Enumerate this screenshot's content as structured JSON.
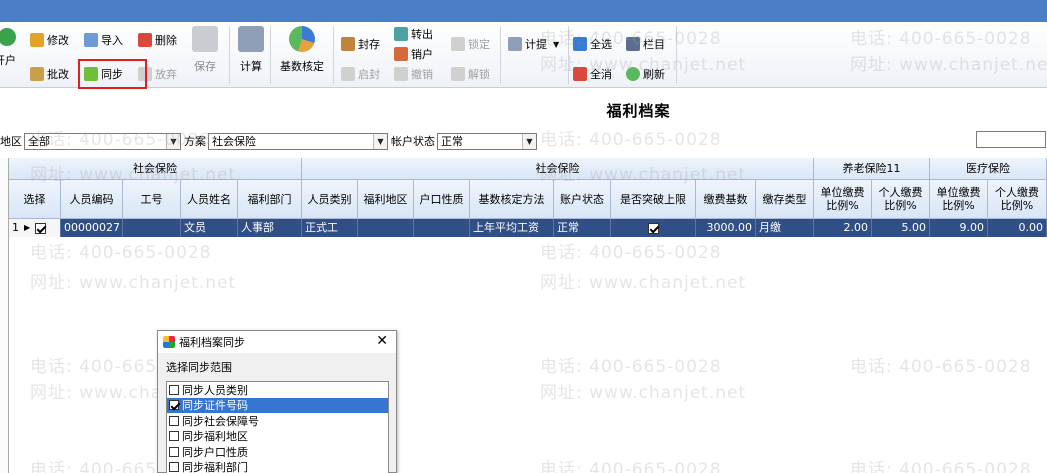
{
  "toolbar": {
    "add_account": "开户",
    "edit": "修改",
    "import": "导入",
    "delete": "删除",
    "batch_edit": "批改",
    "sync": "同步",
    "abandon": "放弃",
    "save": "保存",
    "calculate": "计算",
    "base_verify": "基数核定",
    "seal": "封存",
    "transfer_out": "转出",
    "lock": "锁定",
    "unseal": "启封",
    "cancel_account": "销户",
    "undo_cancel": "撤销",
    "unlock": "解锁",
    "accrue": "计提",
    "select_all": "全选",
    "columns": "栏目",
    "deselect_all": "全消",
    "refresh": "刷新"
  },
  "page_title": "福利档案",
  "filters": {
    "region_label": "地区",
    "region_value": "全部",
    "plan_label": "方案",
    "plan_value": "社会保险",
    "status_label": "帐户状态",
    "status_value": "正常"
  },
  "grid": {
    "group_social1": "社会保险",
    "group_social2": "社会保险",
    "group_pension": "养老保险11",
    "group_medical": "医疗保险",
    "columns": [
      "选择",
      "人员编码",
      "工号",
      "人员姓名",
      "福利部门",
      "人员类别",
      "福利地区",
      "户口性质",
      "基数核定方法",
      "账户状态",
      "是否突破上限",
      "缴费基数",
      "缴存类型",
      "单位缴费比例%",
      "个人缴费比例%",
      "单位缴费比例%",
      "个人缴费比例%"
    ],
    "row": {
      "index": "1",
      "code": "00000027",
      "job_no": "",
      "name": "文员",
      "dept": "人事部",
      "category": "正式工",
      "region": "",
      "hukou": "",
      "base_method": "上年平均工资",
      "status": "正常",
      "base": "3000.00",
      "deposit_type": "月缴",
      "pension_unit": "2.00",
      "pension_personal": "5.00",
      "medical_unit": "9.00",
      "medical_personal": "0.00"
    }
  },
  "dialog": {
    "title": "福利档案同步",
    "subtitle": "选择同步范围",
    "items": [
      "同步人员类别",
      "同步证件号码",
      "同步社会保障号",
      "同步福利地区",
      "同步户口性质",
      "同步福利部门"
    ]
  },
  "watermark": {
    "phone": "电话: 400-665-0028",
    "site": "网址: www.chanjet.net"
  },
  "colors": {
    "titlebar": "#4a7fc8",
    "selected_row": "#2f4f86",
    "highlight_box": "#e02020",
    "dialog_selection": "#3476d2"
  }
}
